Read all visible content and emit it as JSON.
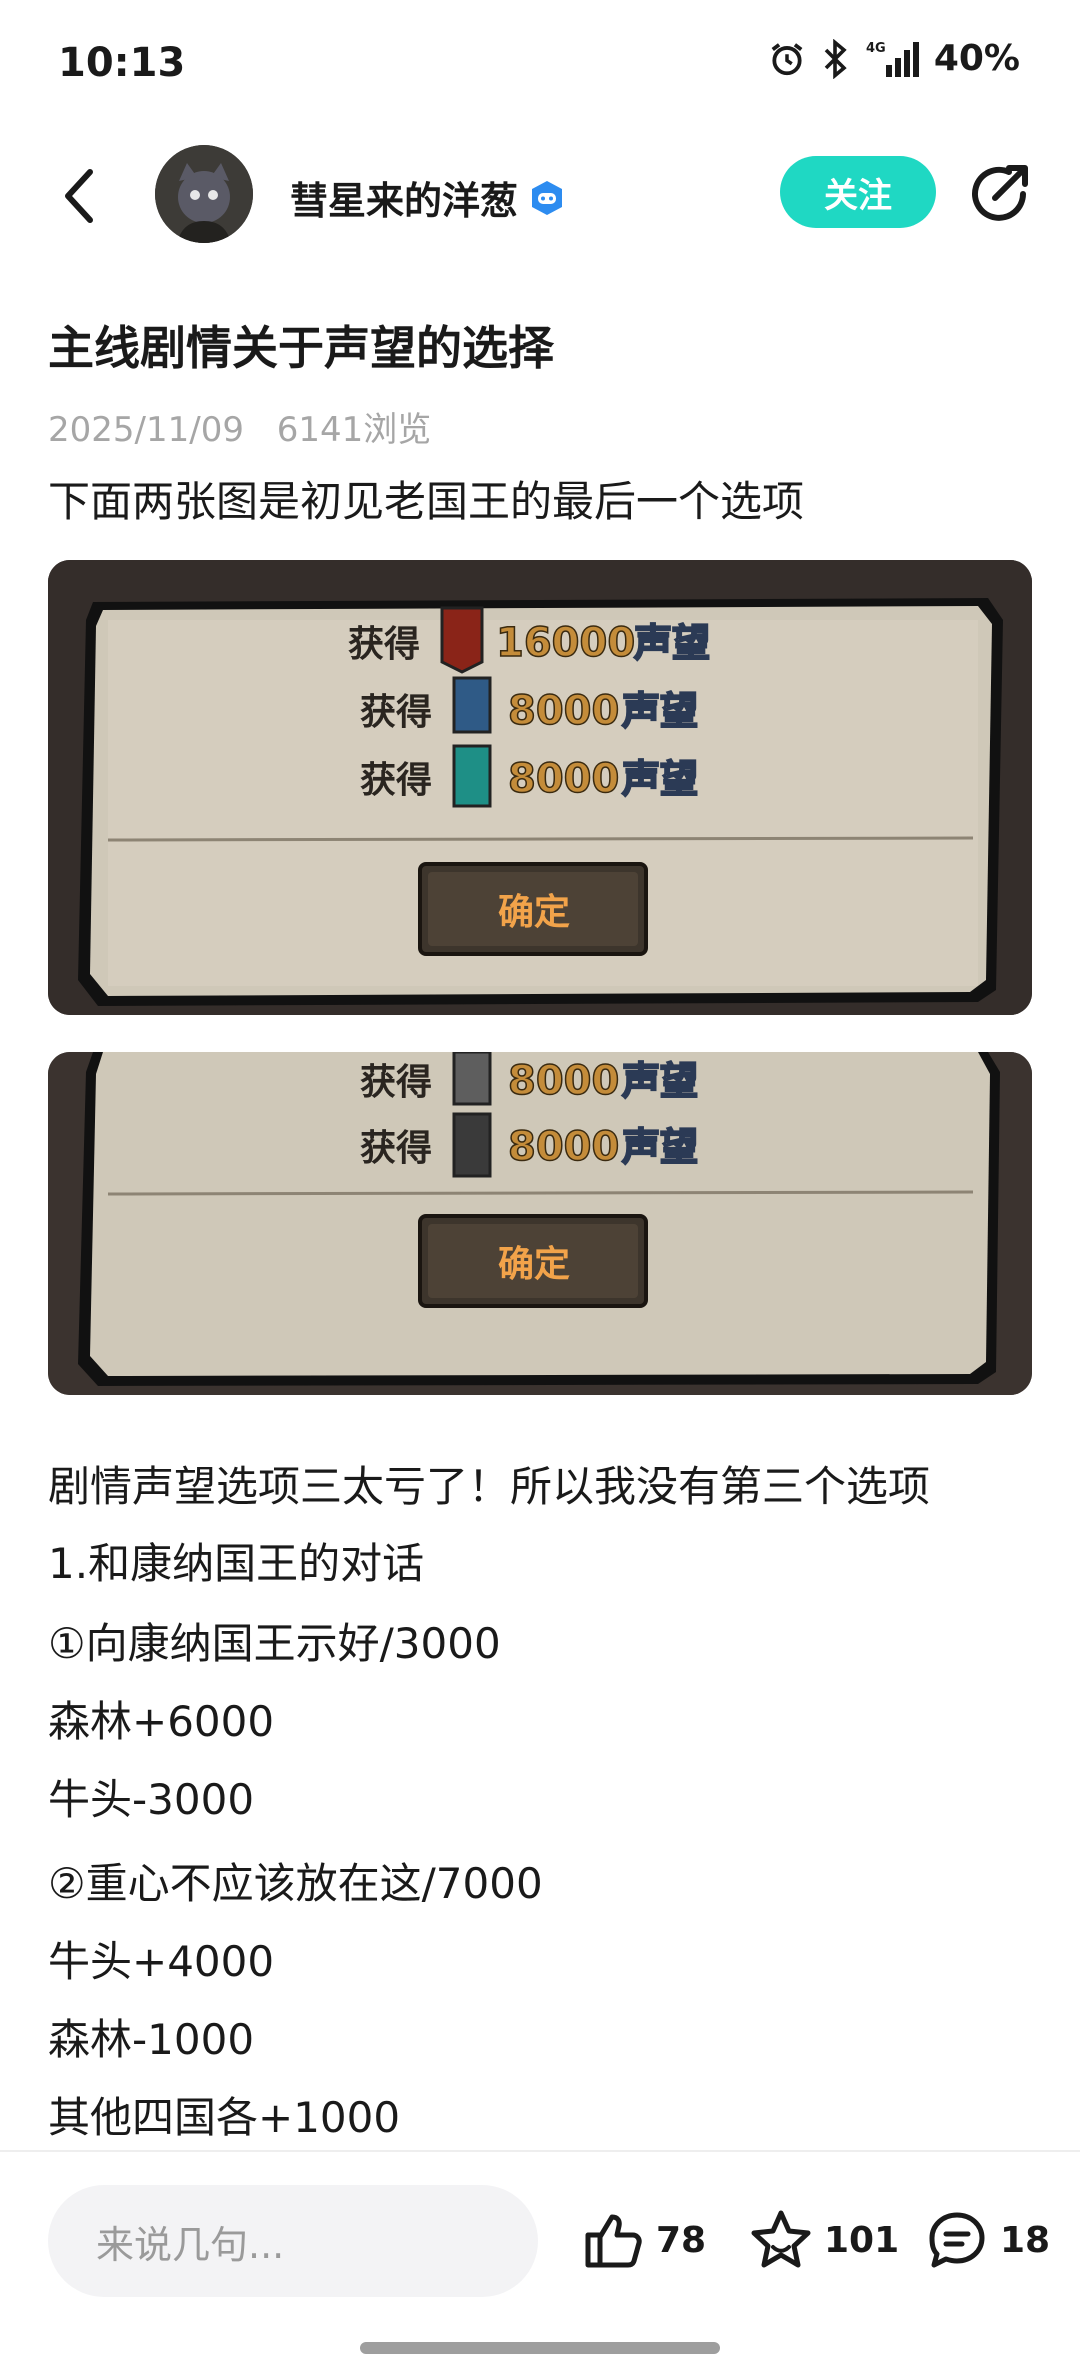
{
  "status": {
    "time": "10:13",
    "battery": "40%",
    "network": "4G"
  },
  "author": {
    "name": "彗星来的洋葱",
    "follow_label": "关注"
  },
  "post": {
    "title": "主线剧情关于声望的选择",
    "date": "2025/11/09",
    "views": "6141浏览",
    "intro": "下面两张图是初见老国王的最后一个选项",
    "lines": [
      "剧情声望选项三太亏了！所以我没有第三个选项",
      "1.和康纳国王的对话",
      "①向康纳国王示好/3000",
      "森林+6000",
      "牛头-3000",
      "②重心不应该放在这/7000",
      "牛头+4000",
      "森林-1000",
      "其他四国各+1000"
    ]
  },
  "image1": {
    "rows": [
      {
        "label": "获得",
        "value": "16000",
        "unit": "声望",
        "banner": "#8a2418"
      },
      {
        "label": "获得",
        "value": "8000",
        "unit": "声望",
        "banner": "#2f5a86"
      },
      {
        "label": "获得",
        "value": "8000",
        "unit": "声望",
        "banner": "#1e8f86"
      }
    ],
    "button": "确定"
  },
  "image2": {
    "rows": [
      {
        "label": "获得",
        "value": "8000",
        "unit": "声望",
        "banner": "#5e5e5e"
      },
      {
        "label": "获得",
        "value": "8000",
        "unit": "声望",
        "banner": "#3a3a3a"
      }
    ],
    "button": "确定"
  },
  "bottom": {
    "comment_placeholder": "来说几句...",
    "likes": "78",
    "favorites": "101",
    "comments": "18"
  }
}
